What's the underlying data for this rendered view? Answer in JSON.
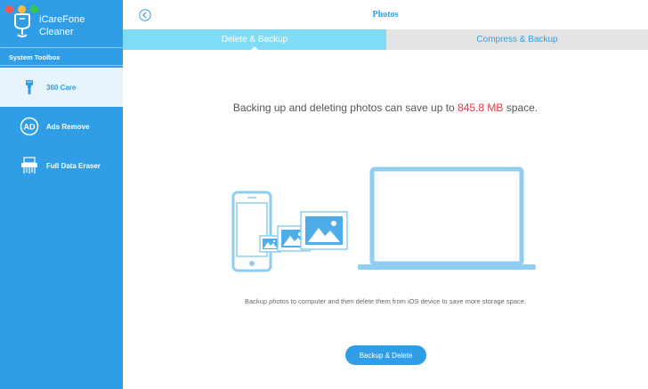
{
  "app": {
    "name_line1": "iCareFone",
    "name_line2": "Cleaner"
  },
  "sidebar": {
    "section_label": "System Toolbox",
    "items": [
      {
        "label": "360 Care",
        "icon": "brush-icon",
        "active": true
      },
      {
        "label": "Ads Remove",
        "icon": "ad-icon",
        "active": false
      },
      {
        "label": "Full Data Eraser",
        "icon": "shredder-icon",
        "active": false
      }
    ]
  },
  "header": {
    "title": "Photos",
    "back_icon": "back-arrow-icon"
  },
  "tabs": [
    {
      "label": "Delete & Backup",
      "active": true
    },
    {
      "label": "Compress & Backup",
      "active": false
    }
  ],
  "main": {
    "headline_prefix": "Backing up and deleting photos can save up to",
    "headline_size": "845.8 MB",
    "headline_suffix": "space.",
    "description": "Backup photos to computer and then delete them from iOS device to save more storage space.",
    "action_button": "Backup & Delete"
  },
  "colors": {
    "sidebar_bg": "#2f9ee6",
    "tab_active_bg": "#7fdcf6",
    "tab_inactive_bg": "#e4e4e4",
    "highlight_red": "#e8363a",
    "illustration_blue": "#8fcdf3"
  }
}
